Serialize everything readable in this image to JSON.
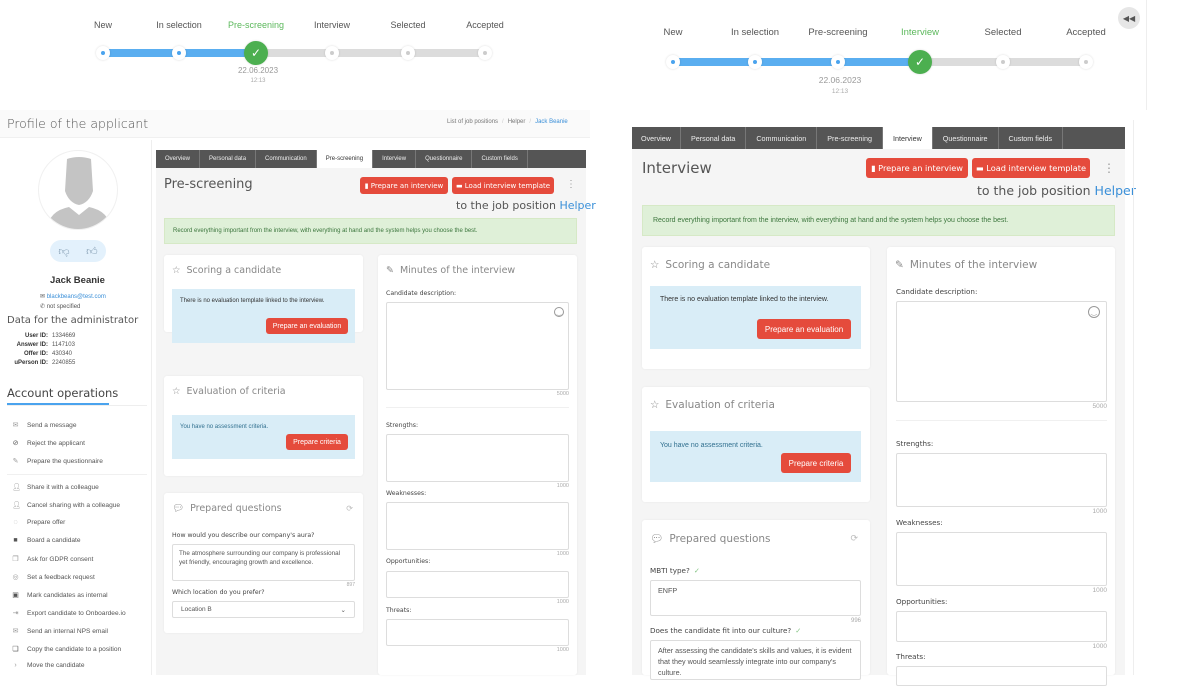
{
  "left_screen": {
    "stepper": {
      "steps": [
        "New",
        "In selection",
        "Pre-screening",
        "Interview",
        "Selected",
        "Accepted"
      ],
      "current_index": 2,
      "current_date": "22.06.2023",
      "current_time": "12:13"
    },
    "profile_title": "Profile of the applicant",
    "breadcrumb": [
      "List of job positions",
      "Helper",
      "Jack Beanie"
    ],
    "applicant": {
      "name": "Jack Beanie",
      "email": "blackbeans@test.com",
      "phone": "not specified"
    },
    "admin": {
      "title": "Data for the administrator",
      "rows": [
        {
          "k": "User ID:",
          "v": "1334669"
        },
        {
          "k": "Answer ID:",
          "v": "1147103"
        },
        {
          "k": "Offer ID:",
          "v": "430340"
        },
        {
          "k": "uPerson ID:",
          "v": "2240855"
        }
      ]
    },
    "operations": {
      "title": "Account operations",
      "group1": [
        {
          "label": "Send a message",
          "icon": "envelope-icon"
        },
        {
          "label": "Reject the applicant",
          "icon": "ban-icon"
        },
        {
          "label": "Prepare the questionnaire",
          "icon": "edit-icon"
        }
      ],
      "group2": [
        {
          "label": "Share it with a colleague",
          "icon": "user-plus-icon"
        },
        {
          "label": "Cancel sharing with a colleague",
          "icon": "user-minus-icon"
        },
        {
          "label": "Prepare offer",
          "icon": "offer-icon"
        },
        {
          "label": "Board a candidate",
          "icon": "briefcase-icon"
        },
        {
          "label": "Ask for GDPR consent",
          "icon": "consent-icon"
        },
        {
          "label": "Set a feedback request",
          "icon": "feedback-icon"
        },
        {
          "label": "Mark candidates as internal",
          "icon": "id-card-icon"
        },
        {
          "label": "Export candidate to Onboardee.io",
          "icon": "export-icon"
        },
        {
          "label": "Send an internal NPS email",
          "icon": "mail-icon"
        },
        {
          "label": "Copy the candidate to a position",
          "icon": "copy-icon"
        },
        {
          "label": "Move the candidate",
          "icon": "arrow-right-icon"
        }
      ]
    },
    "panel": {
      "tabs": [
        "Overview",
        "Personal data",
        "Communication",
        "Pre-screening",
        "Interview",
        "Questionnaire",
        "Custom fields"
      ],
      "active_tab": "Pre-screening",
      "title": "Pre-screening",
      "btn_prepare_interview": "Prepare an interview",
      "btn_load_template": "Load interview template",
      "job_position_prefix": "to the job position",
      "job_position": "Helper",
      "info": "Record everything important from the interview, with everything at hand and the system helps you choose the best.",
      "scoring": {
        "title": "Scoring a candidate",
        "message": "There is no evaluation template linked to the interview.",
        "button": "Prepare an evaluation"
      },
      "criteria": {
        "title": "Evaluation of criteria",
        "message": "You have no assessment criteria.",
        "button": "Prepare criteria"
      },
      "questions": {
        "title": "Prepared questions",
        "q1_label": "How would you describe our company's aura?",
        "q1_value": "The atmosphere surrounding our company is professional yet friendly, encouraging growth and excellence.",
        "q1_counter": "897",
        "q2_label": "Which location do you prefer?",
        "q2_value": "Location B"
      },
      "minutes": {
        "title": "Minutes of the interview",
        "candidate_description": "Candidate description:",
        "cd_counter": "5000",
        "strengths": "Strengths:",
        "weaknesses": "Weaknesses:",
        "opportunities": "Opportunities:",
        "threats": "Threats:",
        "counter": "1000"
      }
    }
  },
  "right_screen": {
    "stepper": {
      "steps": [
        "New",
        "In selection",
        "Pre-screening",
        "Interview",
        "Selected",
        "Accepted"
      ],
      "current_index": 3,
      "date_under_index": 2,
      "date": "22.06.2023",
      "time": "12:13"
    },
    "panel": {
      "tabs": [
        "Overview",
        "Personal data",
        "Communication",
        "Pre-screening",
        "Interview",
        "Questionnaire",
        "Custom fields"
      ],
      "active_tab": "Interview",
      "title": "Interview",
      "btn_prepare_interview": "Prepare an interview",
      "btn_load_template": "Load interview template",
      "job_position_prefix": "to the job position",
      "job_position": "Helper",
      "info": "Record everything important from the interview, with everything at hand and the system helps you choose the best.",
      "scoring": {
        "title": "Scoring a candidate",
        "message": "There is no evaluation template linked to the interview.",
        "button": "Prepare an evaluation"
      },
      "criteria": {
        "title": "Evaluation of criteria",
        "message": "You have no assessment criteria.",
        "button": "Prepare criteria"
      },
      "questions": {
        "title": "Prepared questions",
        "q1_label": "MBTI type?",
        "q1_value": "ENFP",
        "q1_counter": "996",
        "q2_label": "Does the candidate fit into our culture?",
        "q2_value": "After assessing the candidate's skills and values, it is evident that they would seamlessly integrate into our company's culture."
      },
      "minutes": {
        "title": "Minutes of the interview",
        "candidate_description": "Candidate description:",
        "cd_counter": "5000",
        "strengths": "Strengths:",
        "weaknesses": "Weaknesses:",
        "opportunities": "Opportunities:",
        "threats": "Threats:",
        "counter": "1000"
      }
    }
  },
  "colors": {
    "accent_blue": "#5aaef0",
    "success_green": "#4caf50",
    "danger_red": "#e54b3c",
    "link_blue": "#3a8fd8"
  }
}
